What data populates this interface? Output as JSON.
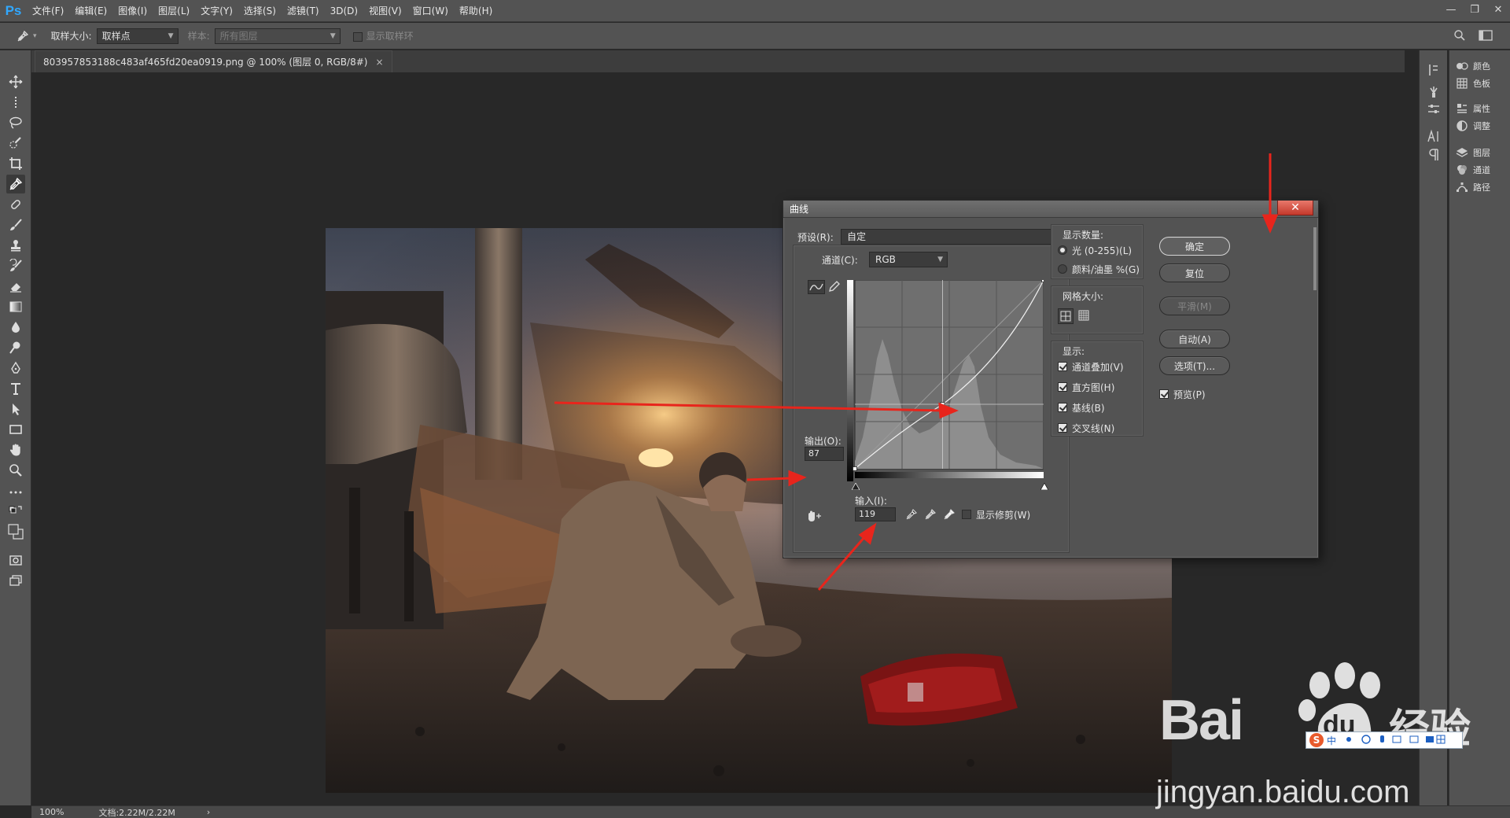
{
  "app": {
    "logo": "Ps",
    "menus": [
      "文件(F)",
      "编辑(E)",
      "图像(I)",
      "图层(L)",
      "文字(Y)",
      "选择(S)",
      "滤镜(T)",
      "3D(D)",
      "视图(V)",
      "窗口(W)",
      "帮助(H)"
    ],
    "window_controls": [
      "—",
      "❐",
      "✕"
    ]
  },
  "options_bar": {
    "sample_size_label": "取样大小:",
    "sample_size_value": "取样点",
    "sample_label": "样本:",
    "sample_value": "所有图层",
    "show_ring_label": "显示取样环"
  },
  "document": {
    "tab_title": "803957853188c483af465fd20ea0919.png @ 100% (图层 0, RGB/8#)",
    "close": "×"
  },
  "status": {
    "zoom": "100%",
    "doc_info": "文档:2.22M/2.22M",
    "arrow": "›"
  },
  "right_panels": {
    "items": [
      "颜色",
      "色板",
      "属性",
      "调整",
      "图层",
      "通道",
      "路径"
    ]
  },
  "curves_dialog": {
    "title": "曲线",
    "close": "✕",
    "preset_label": "预设(R):",
    "preset_value": "自定",
    "channel_label": "通道(C):",
    "channel_value": "RGB",
    "output_label": "输出(O):",
    "output_value": "87",
    "input_label": "输入(I):",
    "input_value": "119",
    "show_clipping_label": "显示修剪(W)",
    "show_amount": {
      "title": "显示数量:",
      "option_light": "光 (0-255)(L)",
      "option_pigment": "颜料/油墨 %(G)",
      "selected": "light"
    },
    "grid_size": {
      "title": "网格大小:"
    },
    "display": {
      "title": "显示:",
      "options": [
        {
          "label": "通道叠加(V)",
          "checked": true
        },
        {
          "label": "直方图(H)",
          "checked": true
        },
        {
          "label": "基线(B)",
          "checked": true
        },
        {
          "label": "交叉线(N)",
          "checked": true
        }
      ]
    },
    "buttons": {
      "ok": "确定",
      "reset": "复位",
      "smooth": "平滑(M)",
      "auto": "自动(A)",
      "options": "选项(T)..."
    },
    "preview_label": "预览(P)",
    "preview_checked": true,
    "curve_point": {
      "input": 119,
      "output": 87
    }
  },
  "watermark": {
    "brand_left": "Bai",
    "brand_right": "经验",
    "url": "jingyan.baidu.com",
    "ime_text": "中"
  },
  "colors": {
    "ps_blue": "#31a8ff",
    "annotation_red": "#e8251c",
    "ui_gray": "#535353"
  }
}
